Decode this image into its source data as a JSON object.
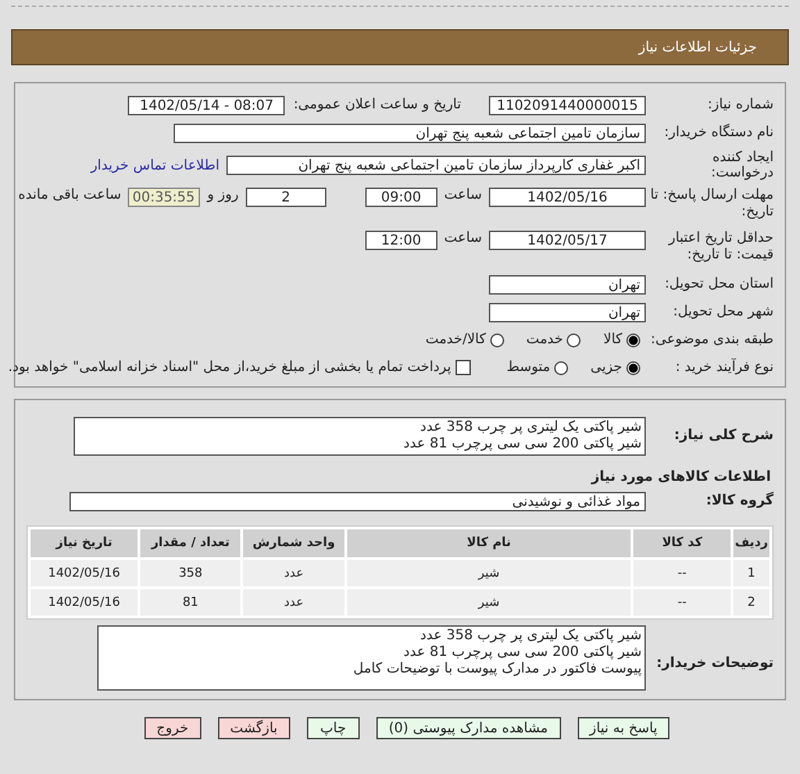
{
  "title": "جزئیات اطلاعات نیاز",
  "need_number": {
    "label": "شماره نیاز:",
    "value": "1102091440000015"
  },
  "announce": {
    "label": "تاریخ و ساعت اعلان عمومی:",
    "value": "1402/05/14 - 08:07"
  },
  "buyer_org": {
    "label": "نام دستگاه خریدار:",
    "value": "سازمان تامین اجتماعی شعبه پنج تهران"
  },
  "requester": {
    "label": "ایجاد کننده درخواست:",
    "value": "اکبر غفاری کارپرداز  سازمان تامین اجتماعی شعبه پنج تهران",
    "link": "اطلاعات تماس خریدار"
  },
  "deadline": {
    "label": "مهلت ارسال پاسخ: تا تاریخ:",
    "date": "1402/05/16",
    "time_label": "ساعت",
    "time": "09:00",
    "days": "2",
    "days_label": "روز و",
    "remaining": "00:35:55",
    "remaining_label": "ساعت باقی مانده"
  },
  "validity": {
    "label": "حداقل تاریخ اعتبار قیمت: تا تاریخ:",
    "date": "1402/05/17",
    "time_label": "ساعت",
    "time": "12:00"
  },
  "province": {
    "label": "استان محل تحویل:",
    "value": "تهران"
  },
  "city": {
    "label": "شهر محل تحویل:",
    "value": "تهران"
  },
  "category": {
    "label": "طبقه بندی موضوعی:",
    "options": [
      {
        "label": "کالا",
        "selected": true
      },
      {
        "label": "خدمت",
        "selected": false
      },
      {
        "label": "کالا/خدمت",
        "selected": false
      }
    ]
  },
  "process": {
    "label": "نوع فرآیند خرید :",
    "options": [
      {
        "label": "جزیی",
        "selected": true
      },
      {
        "label": "متوسط",
        "selected": false
      }
    ],
    "payment": {
      "label": "پرداخت تمام یا بخشی از مبلغ خرید،از محل \"اسناد خزانه اسلامی\" خواهد بود.",
      "checked": false
    }
  },
  "description": {
    "label": "شرح کلی نیاز:",
    "lines": [
      "شیر پاکتی یک لیتری پر چرب 358 عدد",
      "شیر پاکتی 200 سی سی پرچرب 81 عدد"
    ]
  },
  "goods_heading": "اطلاعات کالاهای مورد نیاز",
  "goods_group": {
    "label": "گروه کالا:",
    "value": "مواد غذائی و نوشیدنی"
  },
  "table": {
    "columns": [
      "ردیف",
      "کد کالا",
      "نام کالا",
      "واحد شمارش",
      "تعداد / مقدار",
      "تاریخ نیاز"
    ],
    "rows": [
      [
        "1",
        "--",
        "شیر",
        "عدد",
        "358",
        "1402/05/16"
      ],
      [
        "2",
        "--",
        "شیر",
        "عدد",
        "81",
        "1402/05/16"
      ]
    ]
  },
  "buyer_notes": {
    "label": "توضیحات خریدار:",
    "lines": [
      "شیر پاکتی یک لیتری پر چرب 358 عدد",
      "شیر پاکتی 200 سی سی پرچرب 81 عدد",
      "پیوست فاکتور در مدارک پیوست با توضیحات کامل"
    ]
  },
  "buttons": [
    {
      "label": "پاسخ به نیاز",
      "kind": "action"
    },
    {
      "label": "مشاهده مدارک پیوستی (0)",
      "kind": "action"
    },
    {
      "label": "چاپ",
      "kind": "action"
    },
    {
      "label": "بازگشت",
      "kind": "exit"
    },
    {
      "label": "خروج",
      "kind": "exit"
    }
  ]
}
